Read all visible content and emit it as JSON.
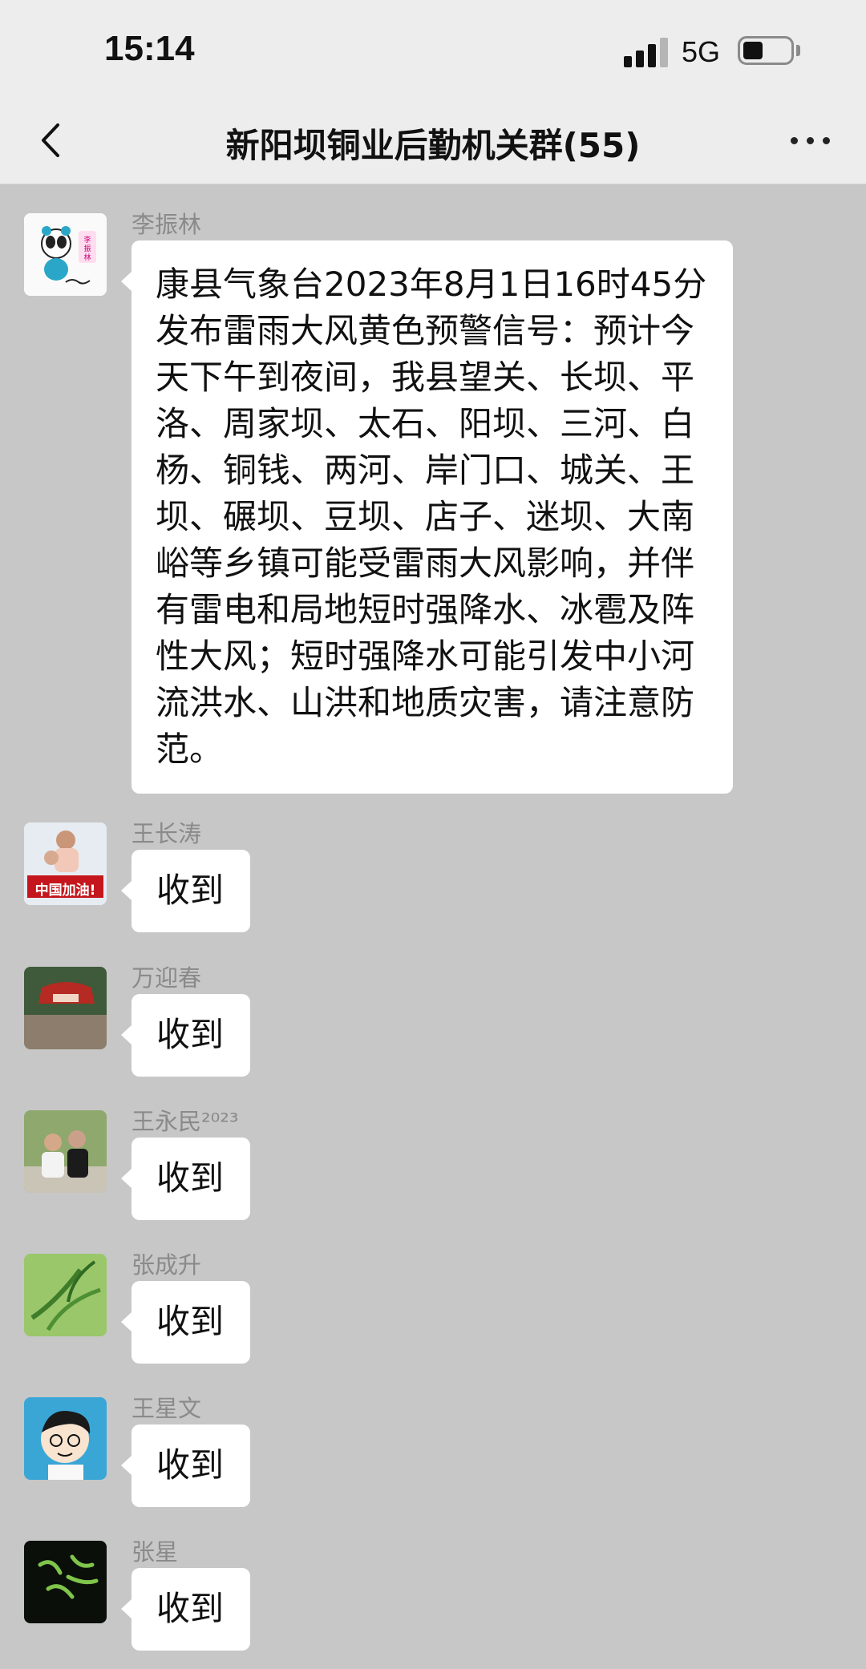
{
  "status": {
    "time": "15:14",
    "network": "5G",
    "battery_level": 0.4
  },
  "header": {
    "title": "新阳坝铜业后勤机关群(55)"
  },
  "messages": [
    {
      "sender": "李振林",
      "avatar": "panda-avatar",
      "text": "康县气象台2023年8月1日16时45分发布雷雨大风黄色预警信号：预计今天下午到夜间，我县望关、长坝、平洛、周家坝、太石、阳坝、三河、白杨、铜钱、两河、岸门口、城关、王坝、碾坝、豆坝、店子、迷坝、大南峪等乡镇可能受雷雨大风影响，并伴有雷电和局地短时强降水、冰雹及阵性大风；短时强降水可能引发中小河流洪水、山洪和地质灾害，请注意防范。"
    },
    {
      "sender": "王长涛",
      "avatar_text": "中国加油!",
      "text": "收到"
    },
    {
      "sender": "万迎春",
      "avatar": "sign-photo-avatar",
      "text": "收到"
    },
    {
      "sender": "王永民²⁰²³",
      "avatar": "people-photo-avatar",
      "text": "收到"
    },
    {
      "sender": "张成升",
      "avatar": "bamboo-avatar",
      "text": "收到"
    },
    {
      "sender": "王星文",
      "avatar": "cartoon-boy-avatar",
      "text": "收到"
    },
    {
      "sender": "张星",
      "avatar": "calligraphy-avatar",
      "text": "收到"
    }
  ],
  "colors": {
    "chat_bg": "#c7c7c7",
    "bubble": "#ffffff",
    "header_bg": "#ededed"
  }
}
